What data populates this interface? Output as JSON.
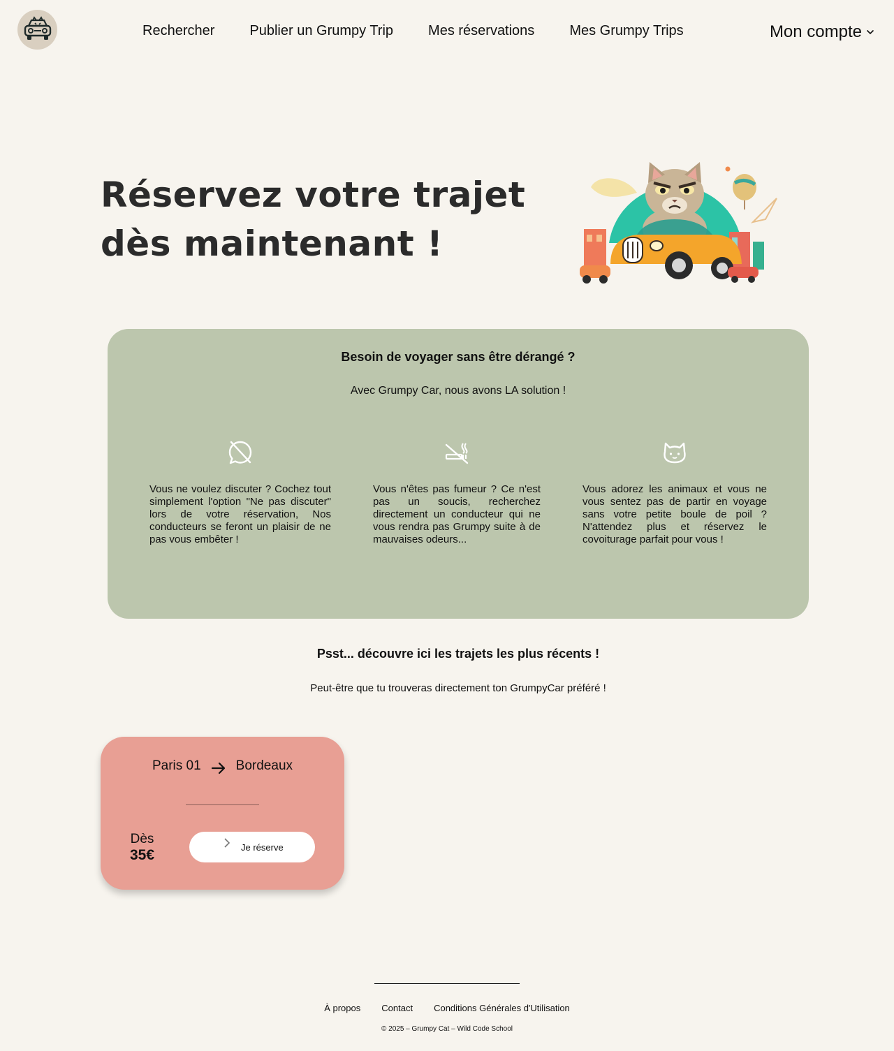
{
  "header": {
    "nav": [
      "Rechercher",
      "Publier un Grumpy Trip",
      "Mes réservations",
      "Mes Grumpy Trips"
    ],
    "account_label": "Mon compte"
  },
  "hero": {
    "title_line1": "Réservez votre trajet",
    "title_line2": "dès maintenant !"
  },
  "features_panel": {
    "title": "Besoin de voyager sans être dérangé ?",
    "subtitle": "Avec Grumpy Car, nous avons LA solution !",
    "items": [
      {
        "icon": "no-chat-icon",
        "text": "Vous ne voulez discuter ? Cochez tout simplement l'option \"Ne pas discuter\" lors de votre réservation, Nos conducteurs se feront un plaisir de ne pas vous embêter !"
      },
      {
        "icon": "no-smoking-icon",
        "text": "Vous n'êtes pas fumeur ? Ce n'est pas un soucis, recherchez directement un conducteur qui ne vous rendra pas Grumpy suite à de mauvaises odeurs..."
      },
      {
        "icon": "cat-icon",
        "text": "Vous adorez les animaux et vous ne vous sentez pas de partir en voyage sans votre petite boule de poil ? N'attendez plus et réservez le covoiturage parfait pour vous !"
      }
    ]
  },
  "recent": {
    "title": "Psst... découvre ici les trajets les plus récents !",
    "subtitle": "Peut-être que tu trouveras directement ton GrumpyCar préféré !"
  },
  "trip_card": {
    "from": "Paris 01",
    "to": "Bordeaux",
    "price_prefix": "Dès",
    "price": "35€",
    "button_label": "Je réserve"
  },
  "footer": {
    "links": [
      "À propos",
      "Contact",
      "Conditions Générales d'Utilisation"
    ],
    "copyright": "© 2025 – Grumpy Cat – Wild Code School"
  },
  "colors": {
    "background": "#f7f4ee",
    "panel": "#bcc6ad",
    "card": "#e89f94"
  }
}
